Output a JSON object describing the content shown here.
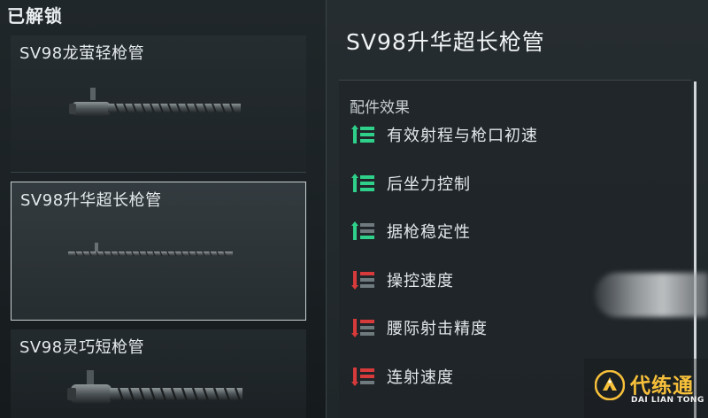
{
  "left_panel": {
    "section_title": "已解锁",
    "items": [
      {
        "name": "SV98龙萤轻枪管",
        "selected": false,
        "art_icon": "short-barrel-icon"
      },
      {
        "name": "SV98升华超长枪管",
        "selected": true,
        "art_icon": "long-barrel-icon"
      },
      {
        "name": "SV98灵巧短枪管",
        "selected": false,
        "art_icon": "compact-barrel-icon"
      }
    ]
  },
  "detail": {
    "title": "SV98升华超长枪管",
    "effects_header": "配件效果",
    "effects": [
      {
        "label": "有效射程与枪口初速",
        "type": "positive",
        "level": 3,
        "icon": "stat-up-icon"
      },
      {
        "label": "后坐力控制",
        "type": "positive",
        "level": 3,
        "icon": "stat-up-icon"
      },
      {
        "label": "据枪稳定性",
        "type": "positive",
        "level": 1,
        "icon": "stat-up-icon"
      },
      {
        "label": "操控速度",
        "type": "negative",
        "level": 1,
        "icon": "stat-down-icon"
      },
      {
        "label": "腰际射击精度",
        "type": "negative",
        "level": 1,
        "icon": "stat-down-icon"
      },
      {
        "label": "连射速度",
        "type": "negative",
        "level": 2,
        "icon": "stat-down-icon"
      }
    ]
  },
  "watermark": {
    "title": "代练通",
    "subtitle": "DAI LIAN TONG",
    "color": "#f7c03a"
  },
  "colors": {
    "positive": "#2fd08a",
    "negative": "#d63a3a",
    "inactive": "#6f7a7e"
  }
}
